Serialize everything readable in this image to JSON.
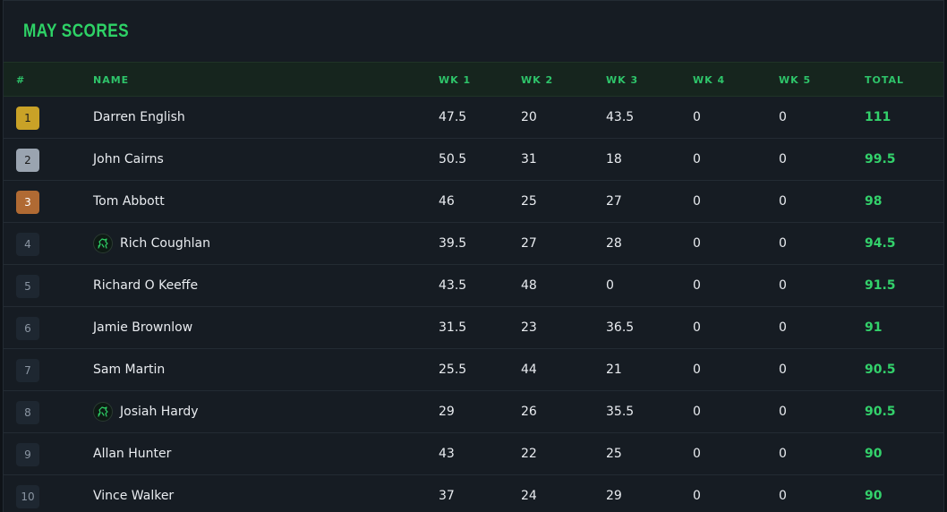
{
  "title": "MAY SCORES",
  "columns": {
    "rank": "#",
    "name": "NAME",
    "wk1": "WK 1",
    "wk2": "WK 2",
    "wk3": "WK 3",
    "wk4": "WK 4",
    "wk5": "WK 5",
    "total": "TOTAL"
  },
  "rows": [
    {
      "rank": "1",
      "name": "Darren English",
      "wk1": "47.5",
      "wk2": "20",
      "wk3": "43.5",
      "wk4": "0",
      "wk5": "0",
      "total": "111"
    },
    {
      "rank": "2",
      "name": "John Cairns",
      "wk1": "50.5",
      "wk2": "31",
      "wk3": "18",
      "wk4": "0",
      "wk5": "0",
      "total": "99.5"
    },
    {
      "rank": "3",
      "name": "Tom Abbott",
      "wk1": "46",
      "wk2": "25",
      "wk3": "27",
      "wk4": "0",
      "wk5": "0",
      "total": "98"
    },
    {
      "rank": "4",
      "name": "Rich Coughlan",
      "wk1": "39.5",
      "wk2": "27",
      "wk3": "28",
      "wk4": "0",
      "wk5": "0",
      "total": "94.5"
    },
    {
      "rank": "5",
      "name": "Richard O Keeffe",
      "wk1": "43.5",
      "wk2": "48",
      "wk3": "0",
      "wk4": "0",
      "wk5": "0",
      "total": "91.5"
    },
    {
      "rank": "6",
      "name": "Jamie Brownlow",
      "wk1": "31.5",
      "wk2": "23",
      "wk3": "36.5",
      "wk4": "0",
      "wk5": "0",
      "total": "91"
    },
    {
      "rank": "7",
      "name": "Sam Martin",
      "wk1": "25.5",
      "wk2": "44",
      "wk3": "21",
      "wk4": "0",
      "wk5": "0",
      "total": "90.5"
    },
    {
      "rank": "8",
      "name": "Josiah Hardy",
      "wk1": "29",
      "wk2": "26",
      "wk3": "35.5",
      "wk4": "0",
      "wk5": "0",
      "total": "90.5"
    },
    {
      "rank": "9",
      "name": "Allan Hunter",
      "wk1": "43",
      "wk2": "22",
      "wk3": "25",
      "wk4": "0",
      "wk5": "0",
      "total": "90"
    },
    {
      "rank": "10",
      "name": "Vince Walker",
      "wk1": "37",
      "wk2": "24",
      "wk3": "29",
      "wk4": "0",
      "wk5": "0",
      "total": "90"
    }
  ],
  "avatar_icon": "horse-racing-icon",
  "colors": {
    "accent": "#2ed266",
    "gold": "#c9a227",
    "silver": "#9aa4b0",
    "bronze": "#b06a33"
  }
}
